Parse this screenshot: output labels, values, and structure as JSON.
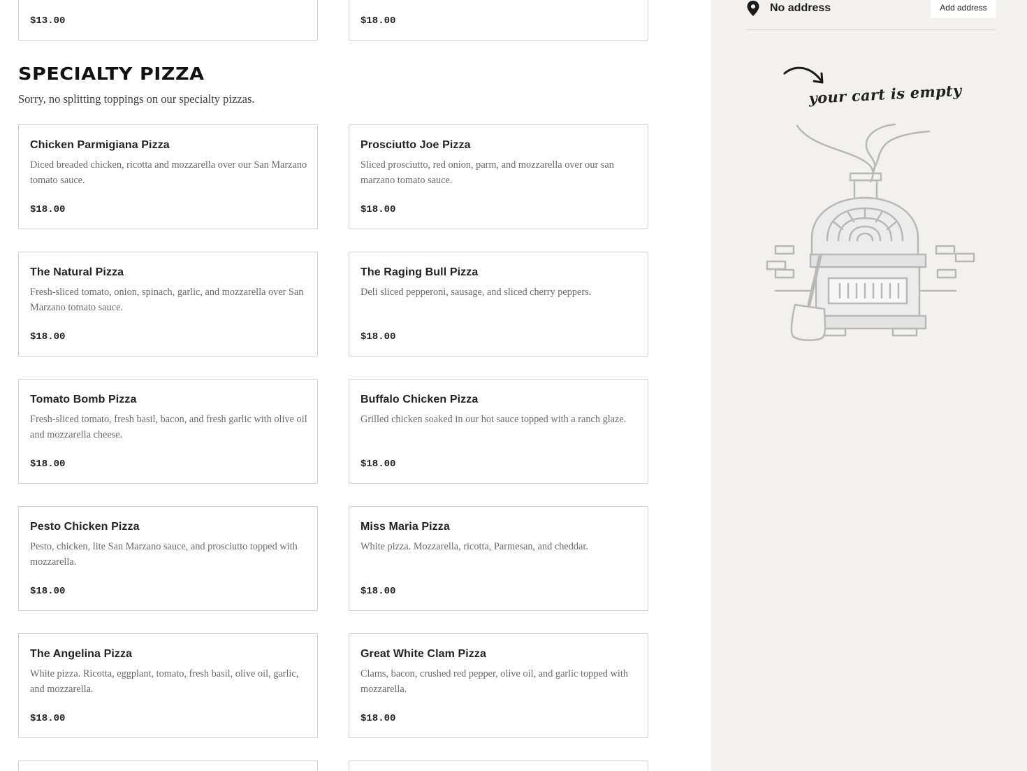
{
  "menu": {
    "previous_items": [
      {
        "price": "$13.00"
      },
      {
        "price": "$18.00"
      }
    ],
    "section": {
      "title": "SPECIALTY PIZZA",
      "note": "Sorry, no splitting toppings on our specialty pizzas."
    },
    "items": [
      {
        "name": "Chicken Parmigiana Pizza",
        "description": "Diced breaded chicken, ricotta and mozzarella over our San Marzano tomato sauce.",
        "price": "$18.00"
      },
      {
        "name": "Prosciutto Joe Pizza",
        "description": "Sliced prosciutto, red onion, parm, and mozzarella over our san marzano tomato sauce.",
        "price": "$18.00"
      },
      {
        "name": "The Natural Pizza",
        "description": "Fresh-sliced tomato, onion, spinach, garlic, and mozzarella over San Marzano tomato sauce.",
        "price": "$18.00"
      },
      {
        "name": "The Raging Bull Pizza",
        "description": "Deli sliced pepperoni, sausage, and sliced cherry peppers.",
        "price": "$18.00"
      },
      {
        "name": "Tomato Bomb Pizza",
        "description": "Fresh-sliced tomato, fresh basil, bacon, and fresh garlic with olive oil and mozzarella cheese.",
        "price": "$18.00"
      },
      {
        "name": "Buffalo Chicken Pizza",
        "description": "Grilled chicken soaked in our hot sauce topped with a ranch glaze.",
        "price": "$18.00"
      },
      {
        "name": "Pesto Chicken Pizza",
        "description": "Pesto, chicken, lite San Marzano sauce, and prosciutto topped with mozzarella.",
        "price": "$18.00"
      },
      {
        "name": "Miss Maria Pizza",
        "description": "White pizza. Mozzarella, ricotta, Parmesan, and cheddar.",
        "price": "$18.00"
      },
      {
        "name": "The Angelina Pizza",
        "description": "White pizza. Ricotta, eggplant, tomato, fresh basil, olive oil, garlic, and mozzarella.",
        "price": "$18.00"
      },
      {
        "name": "Great White Clam Pizza",
        "description": "Clams, bacon, crushed red pepper, olive oil, and garlic topped with mozzarella.",
        "price": "$18.00"
      }
    ]
  },
  "cart": {
    "address_text": "No address",
    "add_address_label": "Add address",
    "empty_label": "your cart is empty",
    "illustration": "pizza-oven-illustration"
  },
  "colors": {
    "page_bg": "#ffffff",
    "sidebar_bg": "#f2f1ee",
    "card_border": "#cfcfcf",
    "text_primary": "#1f1f1f",
    "text_secondary": "#6a6a6a",
    "illustration_line": "#b8b8b8"
  }
}
